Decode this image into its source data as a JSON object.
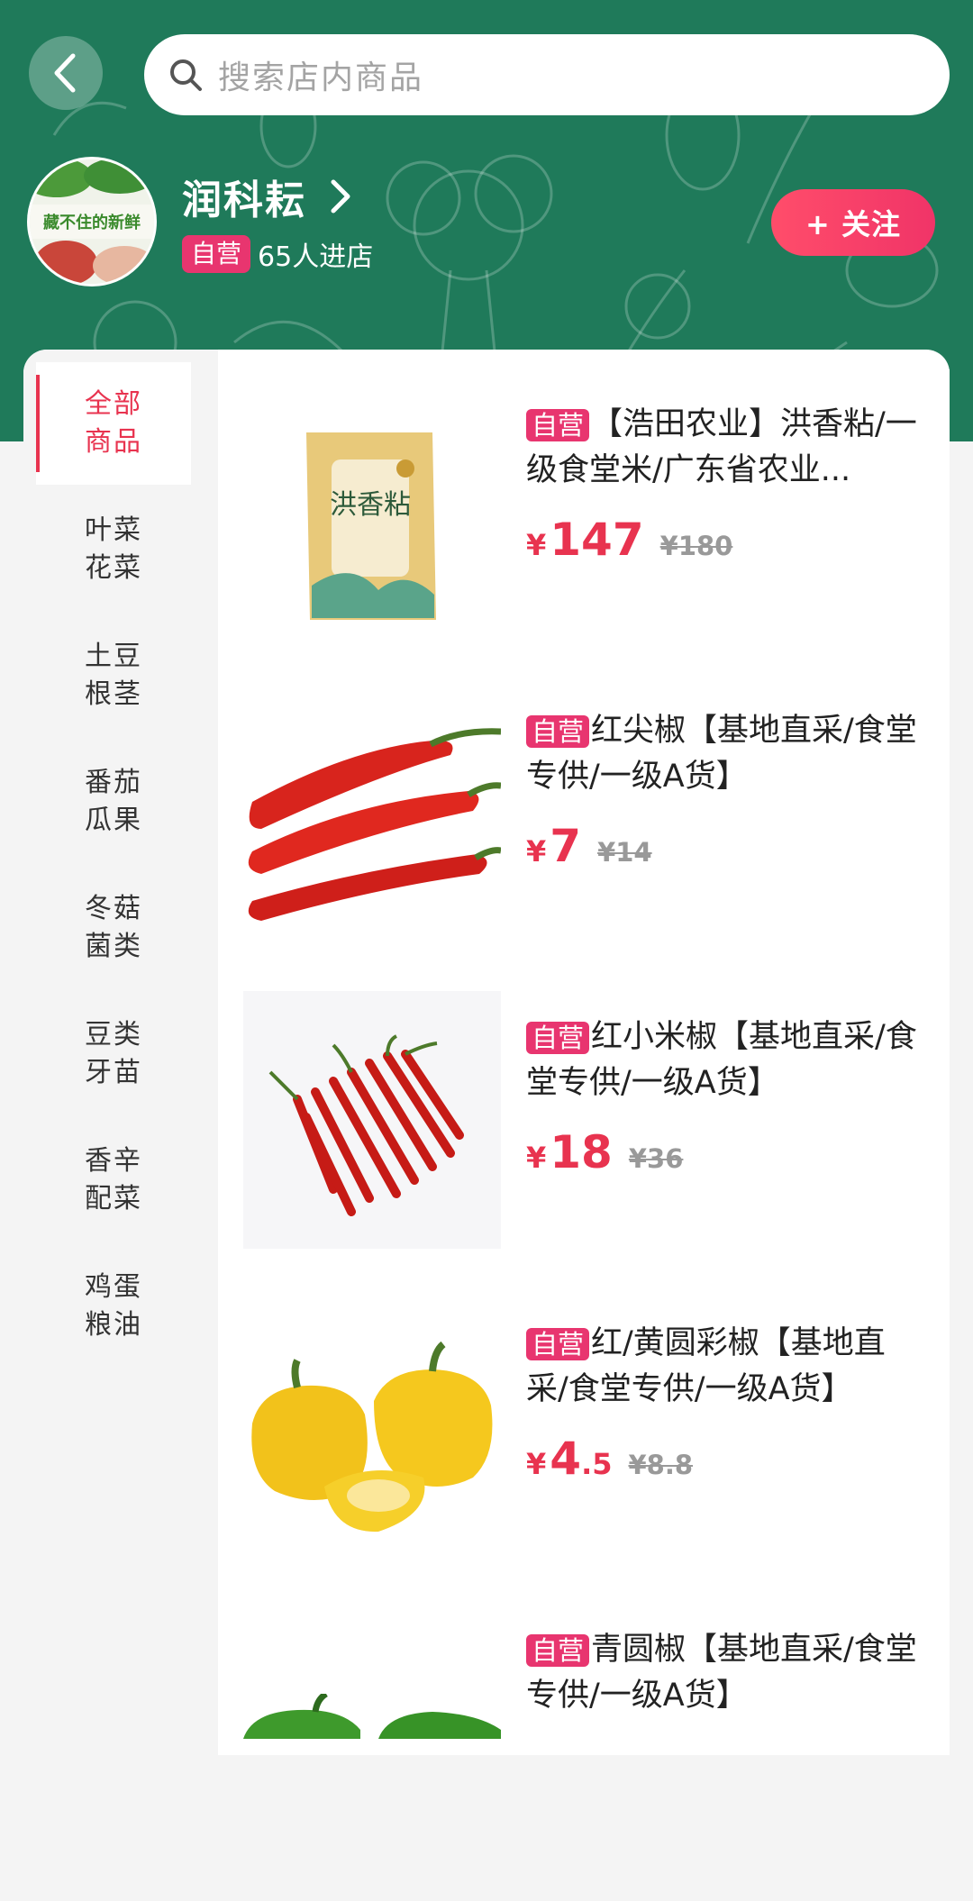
{
  "header": {
    "search_placeholder": "搜索店内商品",
    "shop_name": "润科耘",
    "badge": "自营",
    "visitors": "65人进店",
    "follow_label": "+ 关注",
    "avatar_text": "藏不住的新鲜"
  },
  "categories": [
    {
      "label": "全部商品",
      "active": true
    },
    {
      "label": "叶菜花菜",
      "active": false
    },
    {
      "label": "土豆根茎",
      "active": false
    },
    {
      "label": "番茄瓜果",
      "active": false
    },
    {
      "label": "冬菇菌类",
      "active": false
    },
    {
      "label": "豆类牙苗",
      "active": false
    },
    {
      "label": "香辛配菜",
      "active": false
    },
    {
      "label": "鸡蛋粮油",
      "active": false
    }
  ],
  "products": [
    {
      "tag": "自营",
      "title": "【浩田农业】洪香粘/一级食堂米/广东省农业...",
      "currency": "¥",
      "price_int": "147",
      "price_dec": "",
      "old_price": "¥180",
      "image": "rice-bag",
      "package_text": "洪香粘"
    },
    {
      "tag": "自营",
      "title": "红尖椒【基地直采/食堂专供/一级A货】",
      "currency": "¥",
      "price_int": "7",
      "price_dec": "",
      "old_price": "¥14",
      "image": "red-pepper"
    },
    {
      "tag": "自营",
      "title": "红小米椒【基地直采/食堂专供/一级A货】",
      "currency": "¥",
      "price_int": "18",
      "price_dec": "",
      "old_price": "¥36",
      "image": "red-chili"
    },
    {
      "tag": "自营",
      "title": "红/黄圆彩椒【基地直采/食堂专供/一级A货】",
      "currency": "¥",
      "price_int": "4",
      "price_dec": ".5",
      "old_price": "¥8.8",
      "image": "yellow-bell-pepper"
    },
    {
      "tag": "自营",
      "title": "青圆椒【基地直采/食堂专供/一级A货】",
      "currency": "¥",
      "price_int": "",
      "price_dec": "",
      "old_price": "",
      "image": "green-bell-pepper"
    }
  ],
  "colors": {
    "header_bg": "#1f7a5a",
    "accent": "#e8334f",
    "badge": "#e8356f"
  }
}
